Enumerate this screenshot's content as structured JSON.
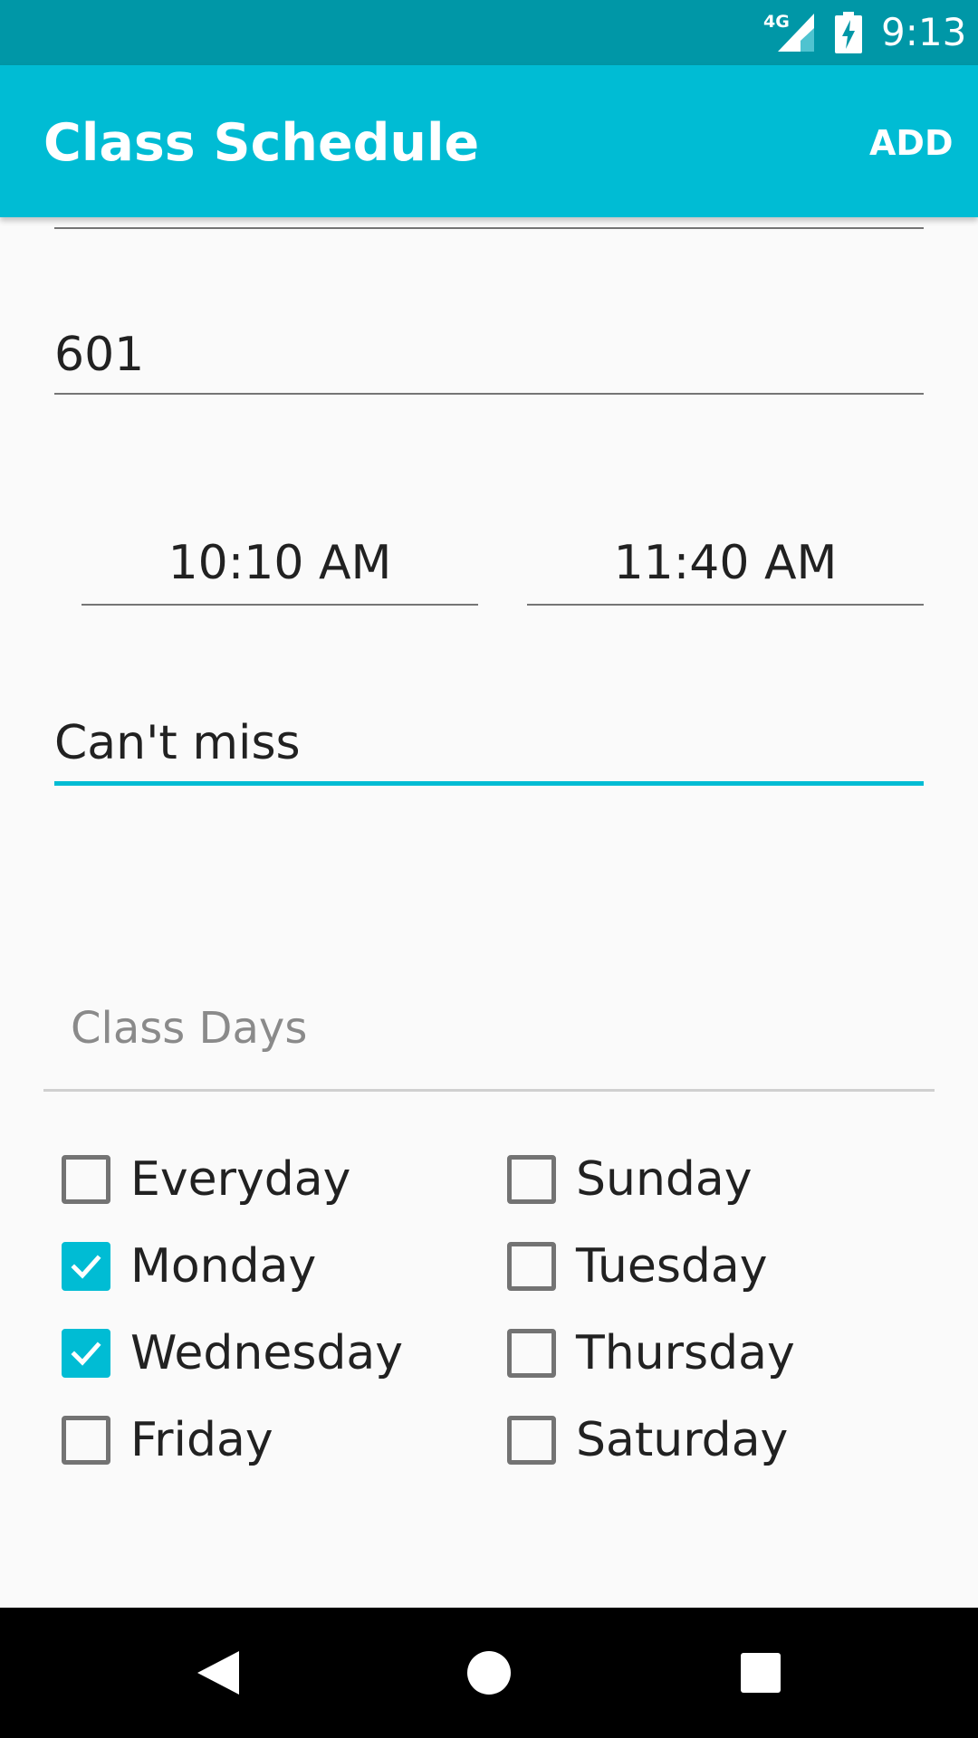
{
  "status_bar": {
    "network": "4G",
    "time": "9:13"
  },
  "app_bar": {
    "title": "Class Schedule",
    "action": "ADD"
  },
  "form": {
    "room": "601",
    "start_time": "10:10 AM",
    "end_time": "11:40 AM",
    "note": "Can't miss",
    "class_days_label": "Class Days"
  },
  "days": {
    "everyday": {
      "label": "Everyday",
      "checked": false
    },
    "sunday": {
      "label": "Sunday",
      "checked": false
    },
    "monday": {
      "label": "Monday",
      "checked": true
    },
    "tuesday": {
      "label": "Tuesday",
      "checked": false
    },
    "wednesday": {
      "label": "Wednesday",
      "checked": true
    },
    "thursday": {
      "label": "Thursday",
      "checked": false
    },
    "friday": {
      "label": "Friday",
      "checked": false
    },
    "saturday": {
      "label": "Saturday",
      "checked": false
    }
  },
  "colors": {
    "status_bar": "#0097a7",
    "app_bar": "#00bcd4",
    "accent": "#00bcd4",
    "background": "#fafafa"
  },
  "icons": {
    "signal": "cellular-signal-icon",
    "battery": "battery-charging-icon",
    "back": "back-triangle-icon",
    "home": "home-circle-icon",
    "recents": "recents-square-icon"
  }
}
